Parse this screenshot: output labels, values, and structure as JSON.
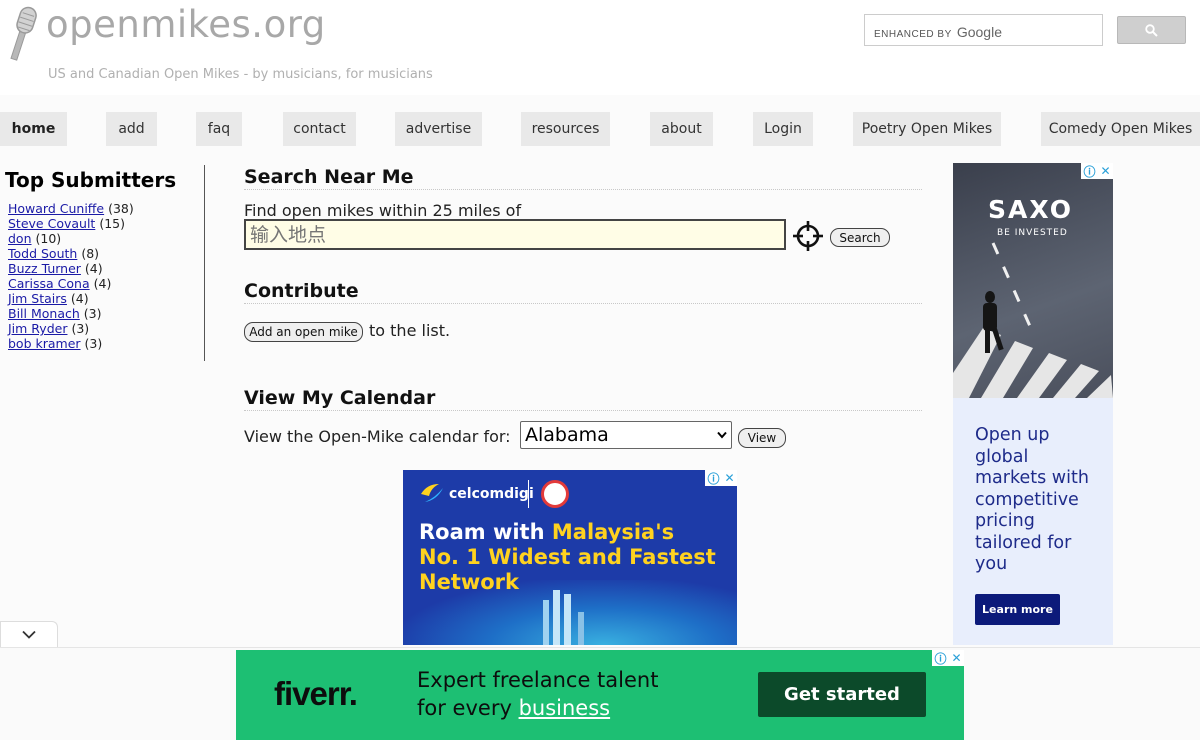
{
  "header": {
    "logo_text": "openmikes.org",
    "tagline": "US and Canadian Open Mikes - by musicians, for musicians",
    "search": {
      "enhanced_by": "ENHANCED BY",
      "google": "Google",
      "placeholder": ""
    }
  },
  "nav": {
    "items": [
      {
        "label": "home"
      },
      {
        "label": "add"
      },
      {
        "label": "faq"
      },
      {
        "label": "contact"
      },
      {
        "label": "advertise"
      },
      {
        "label": "resources"
      },
      {
        "label": "about"
      },
      {
        "label": "Login"
      },
      {
        "label": "Poetry Open Mikes"
      },
      {
        "label": "Comedy Open Mikes"
      }
    ]
  },
  "sidebar": {
    "title": "Top Submitters",
    "submitters": [
      {
        "name": "Howard Cuniffe",
        "count": "(38)"
      },
      {
        "name": "Steve Covault",
        "count": "(15)"
      },
      {
        "name": "don",
        "count": "(10)"
      },
      {
        "name": "Todd South",
        "count": "(8)"
      },
      {
        "name": "Buzz Turner",
        "count": "(4)"
      },
      {
        "name": "Carissa Cona",
        "count": "(4)"
      },
      {
        "name": "Jim Stairs",
        "count": "(4)"
      },
      {
        "name": "Bill Monach",
        "count": "(3)"
      },
      {
        "name": "Jim Ryder",
        "count": "(3)"
      },
      {
        "name": "bob kramer",
        "count": "(3)"
      }
    ]
  },
  "search_near": {
    "heading": "Search Near Me",
    "label": "Find open mikes within 25 miles of",
    "placeholder": "输入地点",
    "button": "Search"
  },
  "contribute": {
    "heading": "Contribute",
    "button": "Add an open mike",
    "suffix": "to the list."
  },
  "calendar": {
    "heading": "View My Calendar",
    "label": "View the Open-Mike calendar for:",
    "selected": "Alabama",
    "button": "View"
  },
  "ads": {
    "saxo": {
      "brand": "SAXO",
      "sub": "BE INVESTED",
      "copy": "Open up global markets with competitive pricing tailored for you",
      "cta": "Learn more"
    },
    "celcom": {
      "brand": "celcomdigi",
      "headline_a": "Roam with ",
      "headline_b": "Malaysia's No. 1 Widest and Fastest Network"
    },
    "fiverr": {
      "brand": "fiverr.",
      "line1": "Expert freelance talent",
      "line2a": "for every ",
      "line2b": "business",
      "cta": "Get started"
    }
  }
}
